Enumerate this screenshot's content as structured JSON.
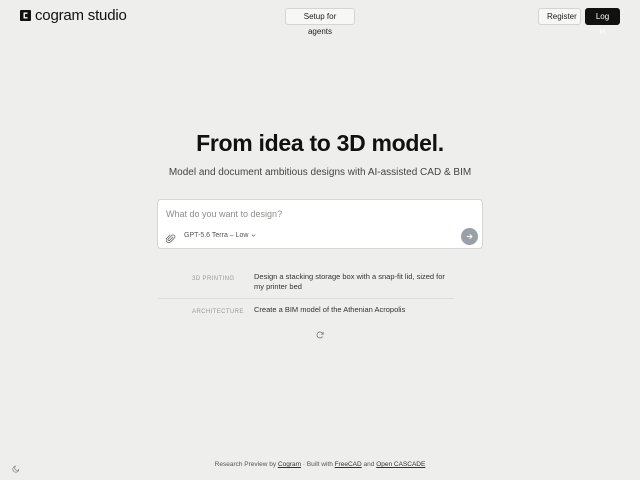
{
  "header": {
    "logo_text": "cogram studio",
    "setup_label": "Setup for agents",
    "register_label": "Register",
    "login_label": "Log in"
  },
  "hero": {
    "title": "From idea to 3D model.",
    "subtitle": "Model and document ambitious designs with AI-assisted CAD & BIM"
  },
  "prompt": {
    "placeholder": "What do you want to design?",
    "value": "",
    "model": "GPT-5.6 Terra – Low",
    "icons": {
      "attach": "paperclip-icon",
      "send": "arrow-right-icon",
      "model": "chevron-down-icon"
    }
  },
  "examples": [
    {
      "category": "3D PRINTING",
      "text": "Design a stacking storage box with a snap-fit lid, sized for my printer bed"
    },
    {
      "category": "ARCHITECTURE",
      "text": "Create a BIM model of the Athenian Acropolis"
    }
  ],
  "footer": {
    "prefix": "Research Preview by",
    "cogram": "Cogram",
    "built": "· Built with",
    "freecad": "FreeCAD",
    "and": "and",
    "opencascade": "Open CASCADE"
  },
  "colors": {
    "accent": "#111111",
    "background": "#eeeeec",
    "send": "#9aa0a8"
  }
}
